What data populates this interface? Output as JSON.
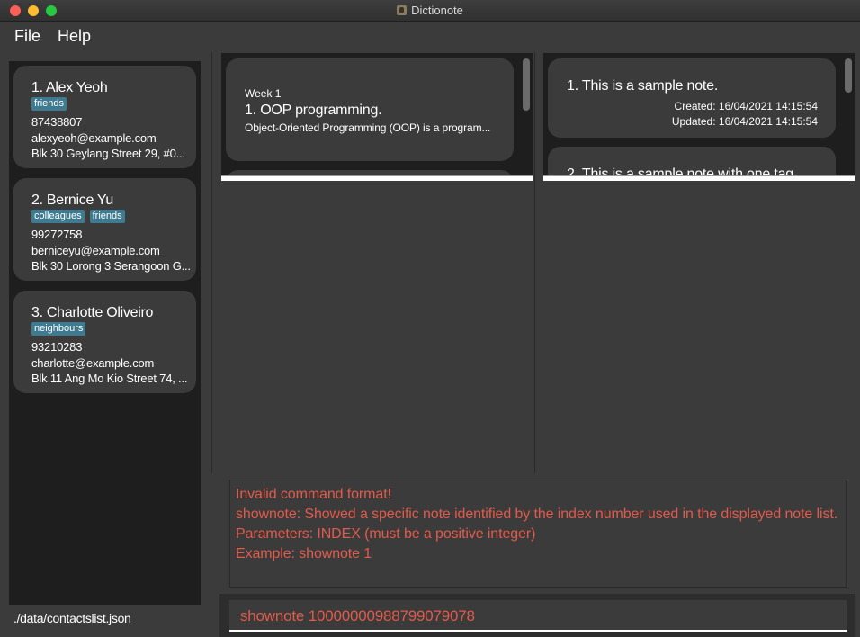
{
  "window": {
    "title": "Dictionote"
  },
  "menu": {
    "file": "File",
    "help": "Help"
  },
  "contacts": [
    {
      "name": "1.  Alex Yeoh",
      "tags": [
        "friends"
      ],
      "phone": "87438807",
      "email": "alexyeoh@example.com",
      "address": "Blk 30 Geylang Street 29, #0..."
    },
    {
      "name": "2.  Bernice Yu",
      "tags": [
        "colleagues",
        "friends"
      ],
      "phone": "99272758",
      "email": "berniceyu@example.com",
      "address": "Blk 30 Lorong 3 Serangoon G..."
    },
    {
      "name": "3.  Charlotte Oliveiro",
      "tags": [
        "neighbours"
      ],
      "phone": "93210283",
      "email": "charlotte@example.com",
      "address": "Blk 11 Ang Mo Kio Street 74, ..."
    }
  ],
  "status": {
    "path": "./data/contactslist.json"
  },
  "content_list": {
    "items": [
      {
        "week": "Week 1",
        "title": "1.  OOP programming.",
        "description": "Object-Oriented Programming (OOP) is a program..."
      }
    ]
  },
  "note_list": {
    "items": [
      {
        "title": "1.  This is a sample note.",
        "created": "Created: 16/04/2021 14:15:54",
        "updated": "Updated: 16/04/2021 14:15:54"
      },
      {
        "title": "2.  This is a sample note with one tag."
      }
    ]
  },
  "result": {
    "lines": [
      "Invalid command format!",
      "shownote: Showed a specific note identified by the index number used in the displayed note list.",
      "Parameters: INDEX (must be a positive integer)",
      "Example: shownote 1"
    ]
  },
  "command": {
    "value": "shownote 10000000988799079078"
  },
  "colors": {
    "error_text": "#e05b4b",
    "tag_bg": "#3e7b91",
    "panel_dark": "#1e1e1e",
    "card_bg": "#3b3b3b"
  }
}
